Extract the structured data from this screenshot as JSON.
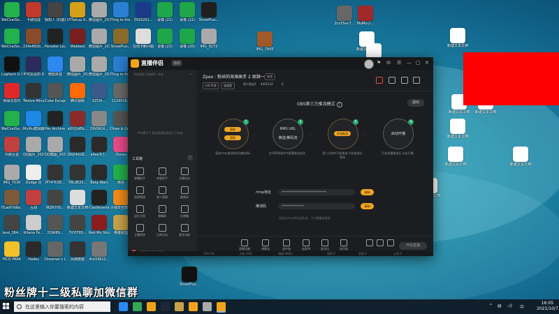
{
  "desktop": {
    "icons": [
      {
        "label": "WeChatSe...",
        "color": "#22b14c"
      },
      {
        "label": "卡碳完成",
        "color": "#c0392b"
      },
      {
        "label": "我想人 (抖能)",
        "color": "#444"
      },
      {
        "label": "UTSetup-6...",
        "color": "#d4a017"
      },
      {
        "label": "微信图片_2021082...",
        "color": "#aaa"
      },
      {
        "label": "Fling to the Finish 修改器",
        "color": "#2a7fd4"
      },
      {
        "label": "3593251...",
        "color": "#1a3a8a"
      },
      {
        "label": "录像 (21)",
        "color": "#1fa64a"
      },
      {
        "label": "录像 (22)",
        "color": "#1fa64a"
      },
      {
        "label": "ShowPlus...",
        "color": "#1f1f1f"
      },
      {
        "label": "WeChatSe...",
        "color": "#22b14c"
      },
      {
        "label": "234e882b...",
        "color": "#8a4b2a"
      },
      {
        "label": "Paradox Launcher v2",
        "color": "#222"
      },
      {
        "label": "Webbed",
        "color": "#7a1e1e"
      },
      {
        "label": "微信图片_2021082...",
        "color": "#aaa"
      },
      {
        "label": "ShowPlus...",
        "color": "#8a6a2a"
      },
      {
        "label": "在线卡断问题汇总",
        "color": "#ddd"
      },
      {
        "label": "录像 (23)",
        "color": "#1fa64a"
      },
      {
        "label": "录像 (26)",
        "color": "#1fa64a"
      },
      {
        "label": "IMG_8272",
        "color": "#aaa"
      },
      {
        "label": "Logitech G HUB",
        "color": "#111"
      },
      {
        "label": "不可思议的 Dance of R...",
        "color": "#2b2b5c"
      },
      {
        "label": "微软拼音",
        "color": "#2d89ef"
      },
      {
        "label": "微信图片_2021082...",
        "color": "#aaa"
      },
      {
        "label": "微信图片_2021082...",
        "color": "#aaa"
      },
      {
        "label": "Fling to the Finish",
        "color": "#2a7fd4"
      },
      {
        "label": "网易云音乐",
        "color": "#e02828"
      },
      {
        "label": "Twelve Minutes",
        "color": "#333"
      },
      {
        "label": "Cube Escape...",
        "color": "#555"
      },
      {
        "label": "腾讯视频",
        "color": "#ff6a00"
      },
      {
        "label": "XZCN·...",
        "color": "#3a5a8a"
      },
      {
        "label": "1129016...",
        "color": "#6a6a6a"
      },
      {
        "label": "WeChatSe...",
        "color": "#22b14c"
      },
      {
        "label": "MuMu模拟器",
        "color": "#1e88e5"
      },
      {
        "label": "Her Archive...",
        "color": "#222"
      },
      {
        "label": "aGYJ2dEb...",
        "color": "#8a2a2a"
      },
      {
        "label": "29V0IGX...",
        "color": "#888"
      },
      {
        "label": "Draw & Guess",
        "color": "#555"
      },
      {
        "label": "内核见证",
        "color": "#c04040"
      },
      {
        "label": "QQ图片_2021082...",
        "color": "#aaa"
      },
      {
        "label": "QQ截图_2021082...",
        "color": "#aaa"
      },
      {
        "label": "QNZ4XGE...",
        "color": "#2a2a2a"
      },
      {
        "label": "a4eeTc7...",
        "color": "#2a2a2a"
      },
      {
        "label": "iTunes",
        "color": "#e84c88"
      },
      {
        "label": "IMG_7530",
        "color": "#aaa"
      },
      {
        "label": "Dodge 同",
        "color": "#eee"
      },
      {
        "label": "IP74TC0E...",
        "color": "#333"
      },
      {
        "label": "78L9E25...",
        "color": "#333"
      },
      {
        "label": "Beta Wars",
        "color": "#2a2a2a"
      },
      {
        "label": "微信",
        "color": "#22b14c"
      },
      {
        "label": "01adf7d6a...",
        "color": "#7a5a3a"
      },
      {
        "label": "互动",
        "color": "#c04040"
      },
      {
        "label": "IRZR7V5...",
        "color": "#444"
      },
      {
        "label": "新建文本文档",
        "color": "#ddd"
      },
      {
        "label": "Castlevania",
        "color": "#222"
      },
      {
        "label": "火绒安全软件",
        "color": "#f08c1a"
      },
      {
        "label": "land_384...",
        "color": "#444"
      },
      {
        "label": "Kitana Fe...",
        "color": "#ccc"
      },
      {
        "label": "2OW89...",
        "color": "#555"
      },
      {
        "label": "7VYIT05...",
        "color": "#444"
      },
      {
        "label": "Red Mo Studio",
        "color": "#8a1e1e"
      },
      {
        "label": "英雄联盟",
        "color": "#c8a24a"
      },
      {
        "label": "PICO PARK",
        "color": "#f3c12a"
      },
      {
        "label": "Hades",
        "color": "#2a2a2a"
      },
      {
        "label": "Dreamer's Life",
        "color": "#666"
      },
      {
        "label": "风雨数据",
        "color": "#333"
      },
      {
        "label": "4rd33812...",
        "color": "#777"
      }
    ],
    "right_icons": [
      {
        "label": "2cc55ec7...",
        "color": "#666"
      },
      {
        "label": "MuMu小...",
        "color": "#a02a2a"
      },
      {
        "label": "新建文本文档 (5)",
        "color": "#fff"
      },
      {
        "label": "IMG_7905",
        "color": "#a05a2a"
      },
      {
        "label": "新建文本文档 (6)",
        "color": "#fff"
      },
      {
        "label": "新建文本文档 (4)",
        "color": "#fff"
      },
      {
        "label": "新建文本文档 (2)",
        "color": "#fff"
      },
      {
        "label": "新建文本文档 (3)",
        "color": "#fff"
      },
      {
        "label": "新建文本文档 (7)",
        "color": "#fff"
      },
      {
        "label": "新建文本文档 (2)",
        "color": "#fff"
      },
      {
        "label": "新建文本文档 (1)",
        "color": "#fff"
      },
      {
        "label": "新建文本文档",
        "color": "#fff"
      },
      {
        "label": "新建文本文档",
        "color": "#fff"
      },
      {
        "label": "ShowPlus...",
        "color": "#111"
      }
    ]
  },
  "app": {
    "title": "直播伴侣",
    "badge": "旗舰",
    "titlebar_buttons": [
      "⚑",
      "✉",
      "☰",
      "—",
      "▢",
      "✕"
    ],
    "left": {
      "hint": "添加画面  添加图片  添加...",
      "empty_text": "OBS模式下  推送直播用画面下方添加",
      "tools_title": "工具箱",
      "tools": [
        "弹幕助手",
        "房管助手",
        "主播任务",
        "投票管理",
        "禁人管理",
        "摄像屏",
        "送礼方案",
        "弹幕屏",
        "礼物箱",
        "主播闹钟",
        "日常活动",
        "更多功能"
      ],
      "footer": "斗鱼直播伴侣使用帮助"
    },
    "main": {
      "room_title": "Zpao : 粉丝的海滩高手 2 原顾一",
      "edit_label": "修改",
      "tags": [
        "LOL手游",
        "极速版",
        "同二首长2",
        "4452132",
        "0"
      ],
      "obs_mode_title": "OBS第三方推流模式",
      "exit_label": "退出",
      "steps": [
        {
          "num": "1",
          "pill_top": "获取",
          "pill_bottom": "获取",
          "desc": "获取rtmp推流地址和推流码"
        },
        {
          "num": "2",
          "line1": "RMS URL",
          "line2": "推送/推码流",
          "desc": "在OBS等软件中配置推流信息"
        },
        {
          "num": "3",
          "pill": "开始推流",
          "desc": "第三方软件开始推流 开启推流后等待"
        },
        {
          "num": "4",
          "line1": "启动开播",
          "desc": "开启直播推流后 点击开播"
        }
      ],
      "rtmp_label": "rtmp地址",
      "rtmp_value": "********************************",
      "code_label": "推流码",
      "code_value": "****************",
      "copy_label": "复制",
      "hint": "关闭后rtmp地址会失效，下次需重新复制",
      "bottom_buttons": [
        "直播顶端",
        "弹幕池",
        "画中画",
        "连麦PK",
        "麦克风",
        "扬声器"
      ],
      "start_label": "开始直播"
    },
    "status": [
      "CPU 5%",
      "内存 45%",
      "网络 0KB/s",
      "帧率 0",
      "丢帧 0",
      "上传 0"
    ]
  },
  "caption": "粉丝牌十二级私聊加微信群",
  "taskbar": {
    "search_placeholder": "在这里输入你要搜索的内容",
    "time": "16:05",
    "date": "2021/10/7",
    "apps": [
      "#2d89ef",
      "#34a853",
      "#f3a31b",
      "#1b2838",
      "#c8a24a",
      "#f3a31b",
      "#aaa",
      "#f3a31b"
    ]
  }
}
